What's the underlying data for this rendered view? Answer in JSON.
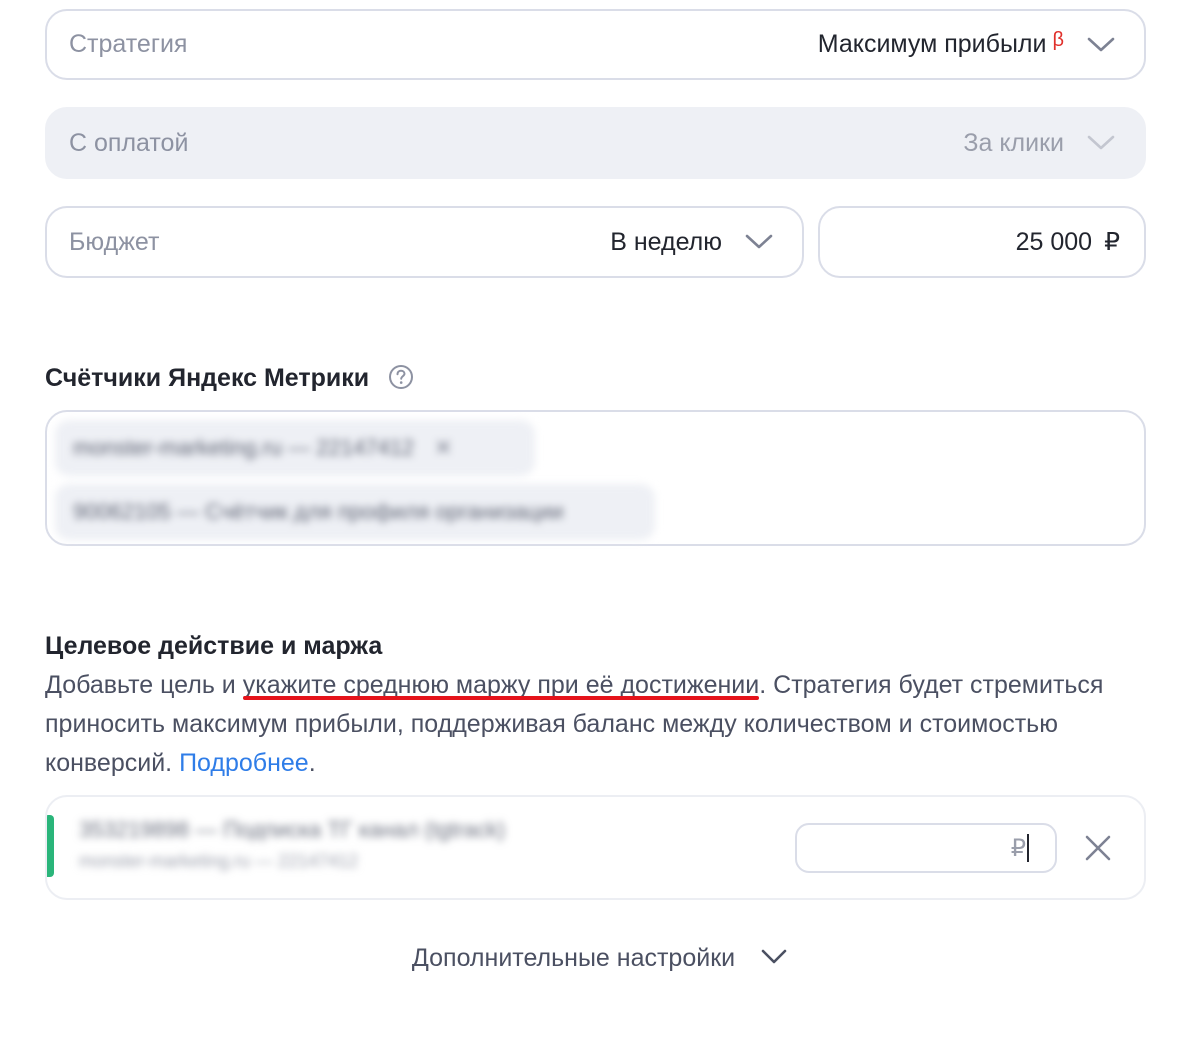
{
  "strategy": {
    "label": "Стратегия",
    "value": "Максимум прибыли",
    "beta": "β"
  },
  "payment": {
    "label": "С оплатой",
    "value": "За клики"
  },
  "budget": {
    "label": "Бюджет",
    "period": "В неделю",
    "amount": "25 000",
    "currency": "₽"
  },
  "counters": {
    "title": "Счётчики Яндекс Метрики",
    "chips": [
      "monster-marketing.ru — 22147412",
      "90062105 — Счётчик для профиля организации"
    ]
  },
  "target": {
    "title": "Целевое действие и маржа",
    "desc_before": "Добавьте цель и ",
    "desc_highlight": "укажите среднюю маржу при её достижении",
    "desc_after": ". Стратегия будет стремиться приносить максимум прибыли, поддерживая баланс между количеством и стоимостью конверсий. ",
    "link": "Подробнее",
    "link_after": ".",
    "goal": {
      "name": "353219898 — Подписка ТГ канал (tgtrack)",
      "counter": "monster-marketing.ru — 22147412",
      "currency": "₽"
    }
  },
  "more_settings": "Дополнительные настройки",
  "colors": {
    "accent_link": "#2f7de8",
    "goal_stripe": "#2ab57a",
    "underline": "#e5131b",
    "beta": "#e0302b"
  },
  "icons": {
    "dropdown": "chevron-down-icon",
    "help": "question-circle-icon",
    "remove": "close-icon"
  }
}
